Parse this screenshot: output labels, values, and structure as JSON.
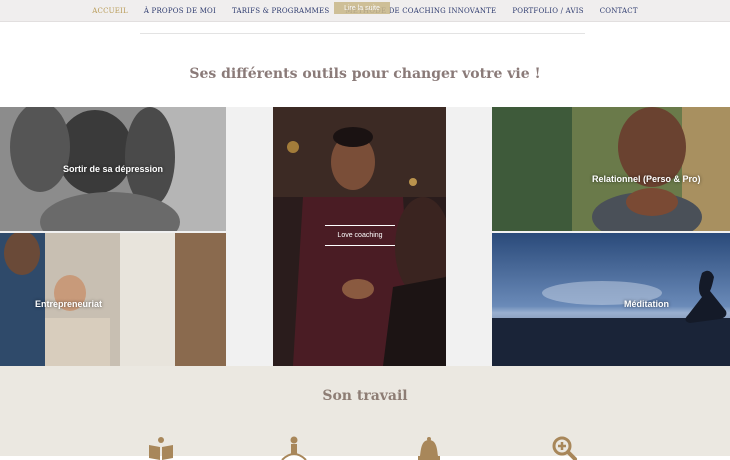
{
  "nav": {
    "items": [
      {
        "label": "ACCUEIL",
        "active": true
      },
      {
        "label": "À PROPOS DE MOI",
        "active": false
      },
      {
        "label": "TARIFS & PROGRAMMES",
        "active": false
      },
      {
        "label": "MÉTHODE DE COACHING INNOVANTE",
        "active": false
      },
      {
        "label": "PORTFOLIO / AVIS",
        "active": false
      },
      {
        "label": "CONTACT",
        "active": false
      }
    ],
    "read_more": "Lire la suite"
  },
  "tools": {
    "title": "Ses différents outils pour changer votre vie !",
    "tiles": [
      {
        "label": "Sortir de sa dépression"
      },
      {
        "label": "Entrepreneuriat"
      },
      {
        "label": "Love coaching"
      },
      {
        "label": "Relationnel (Perso & Pro)"
      },
      {
        "label": "Méditation"
      }
    ]
  },
  "work": {
    "title": "Son travail",
    "icons": [
      "book-icon",
      "person-balance-icon",
      "bell-icon",
      "zoom-in-icon"
    ]
  },
  "colors": {
    "nav_text": "#2d3a6e",
    "accent_gold": "#b89a55",
    "title_text": "#8a7a78",
    "work_bg": "#ebe8e1",
    "icon_color": "#a8875a"
  }
}
